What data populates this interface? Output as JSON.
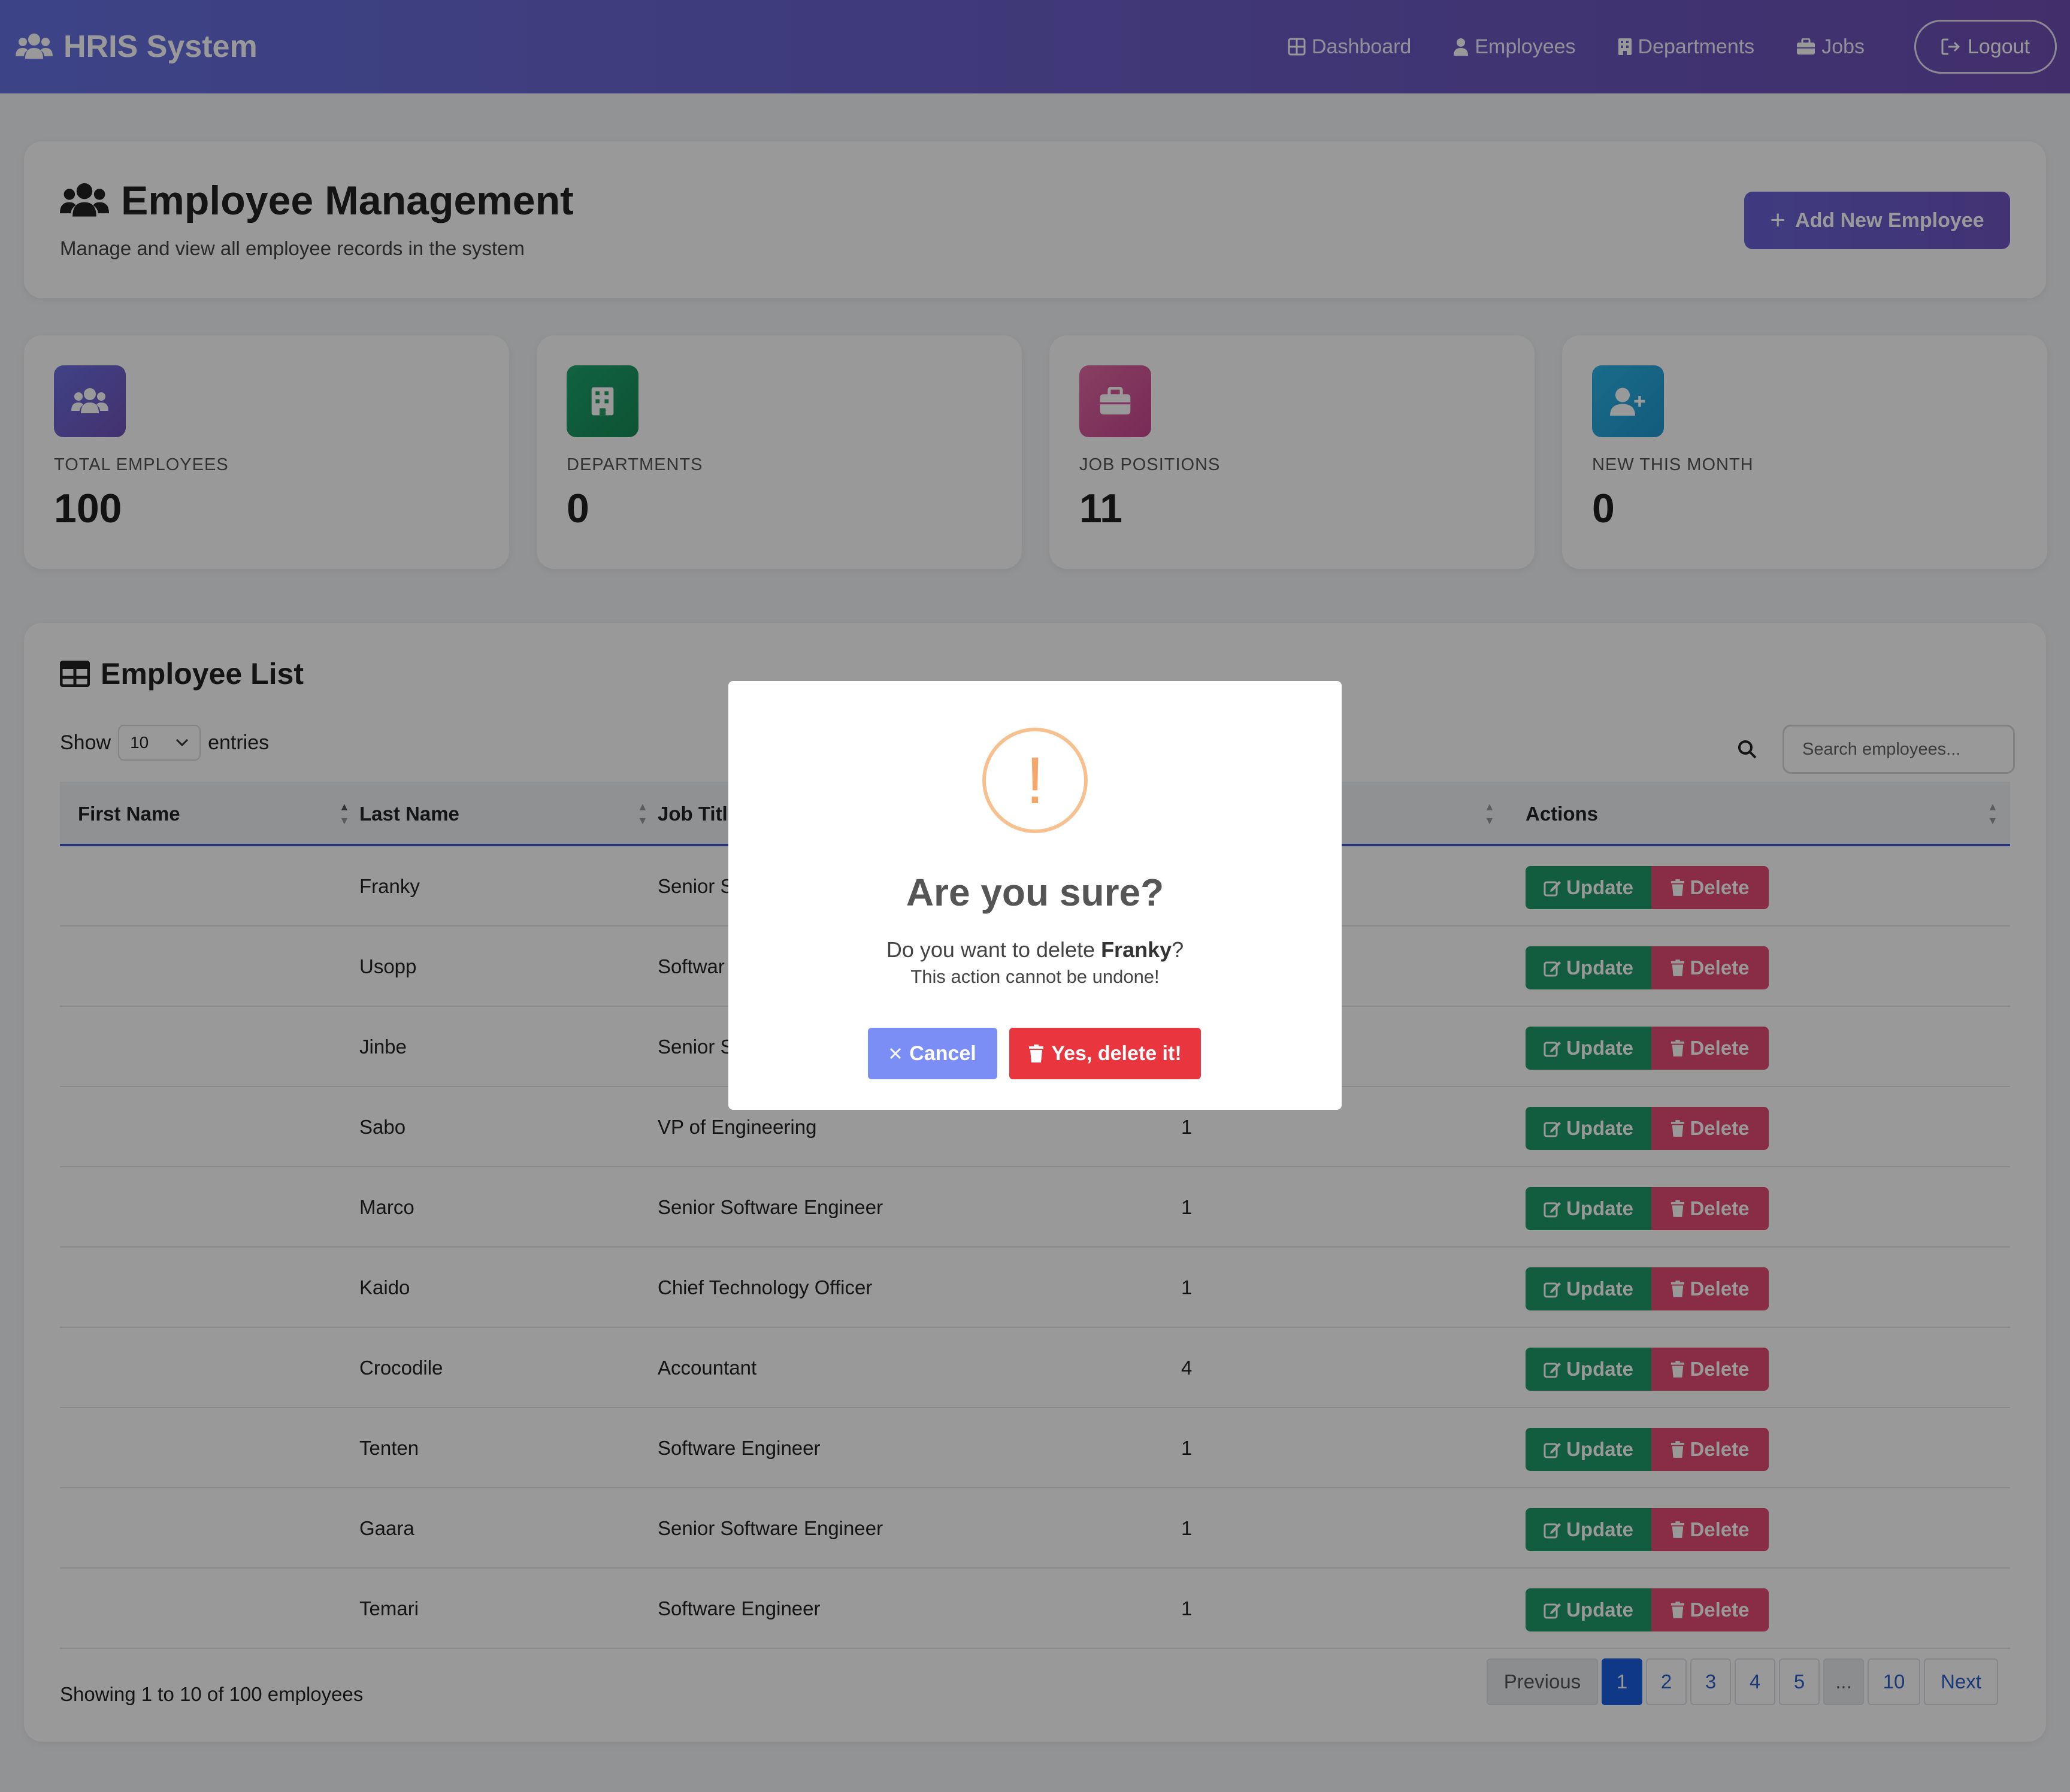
{
  "navbar": {
    "brand": "HRIS System",
    "links": [
      "Dashboard",
      "Employees",
      "Departments",
      "Jobs"
    ],
    "logout": "Logout"
  },
  "header": {
    "title": "Employee Management",
    "subtitle": "Manage and view all employee records in the system",
    "add_button": "Add New Employee"
  },
  "stats": [
    {
      "label": "TOTAL EMPLOYEES",
      "value": "100",
      "color": "#6b60d0",
      "icon": "users-icon"
    },
    {
      "label": "DEPARTMENTS",
      "value": "0",
      "color": "#1e9c64",
      "icon": "building-icon"
    },
    {
      "label": "JOB POSITIONS",
      "value": "11",
      "color": "#d4549e",
      "icon": "briefcase-icon"
    },
    {
      "label": "NEW THIS MONTH",
      "value": "0",
      "color": "#26a7db",
      "icon": "user-plus-icon"
    }
  ],
  "list": {
    "title": "Employee List",
    "show_label": "Show",
    "entries_label": "entries",
    "page_size": "10",
    "search_placeholder": "Search employees...",
    "columns": [
      "First Name",
      "Last Name",
      "Job Title",
      "Actions"
    ],
    "rows": [
      {
        "first": "",
        "last": "Franky",
        "job": "Senior S",
        "dept": ""
      },
      {
        "first": "",
        "last": "Usopp",
        "job": "Softwar",
        "dept": ""
      },
      {
        "first": "",
        "last": "Jinbe",
        "job": "Senior S",
        "dept": ""
      },
      {
        "first": "",
        "last": "Sabo",
        "job": "VP of Engineering",
        "dept": "1"
      },
      {
        "first": "",
        "last": "Marco",
        "job": "Senior Software Engineer",
        "dept": "1"
      },
      {
        "first": "",
        "last": "Kaido",
        "job": "Chief Technology Officer",
        "dept": "1"
      },
      {
        "first": "",
        "last": "Crocodile",
        "job": "Accountant",
        "dept": "4"
      },
      {
        "first": "",
        "last": "Tenten",
        "job": "Software Engineer",
        "dept": "1"
      },
      {
        "first": "",
        "last": "Gaara",
        "job": "Senior Software Engineer",
        "dept": "1"
      },
      {
        "first": "",
        "last": "Temari",
        "job": "Software Engineer",
        "dept": "1"
      }
    ],
    "update_label": "Update",
    "delete_label": "Delete",
    "showing": "Showing 1 to 10 of 100 employees",
    "pagination": [
      "Previous",
      "1",
      "2",
      "3",
      "4",
      "5",
      "...",
      "10",
      "Next"
    ]
  },
  "modal": {
    "title": "Are you sure?",
    "text_prefix": "Do you want to delete ",
    "target": "Franky",
    "text_suffix": "?",
    "subtext": "This action cannot be undone!",
    "cancel": "Cancel",
    "confirm": "Yes, delete it!"
  }
}
